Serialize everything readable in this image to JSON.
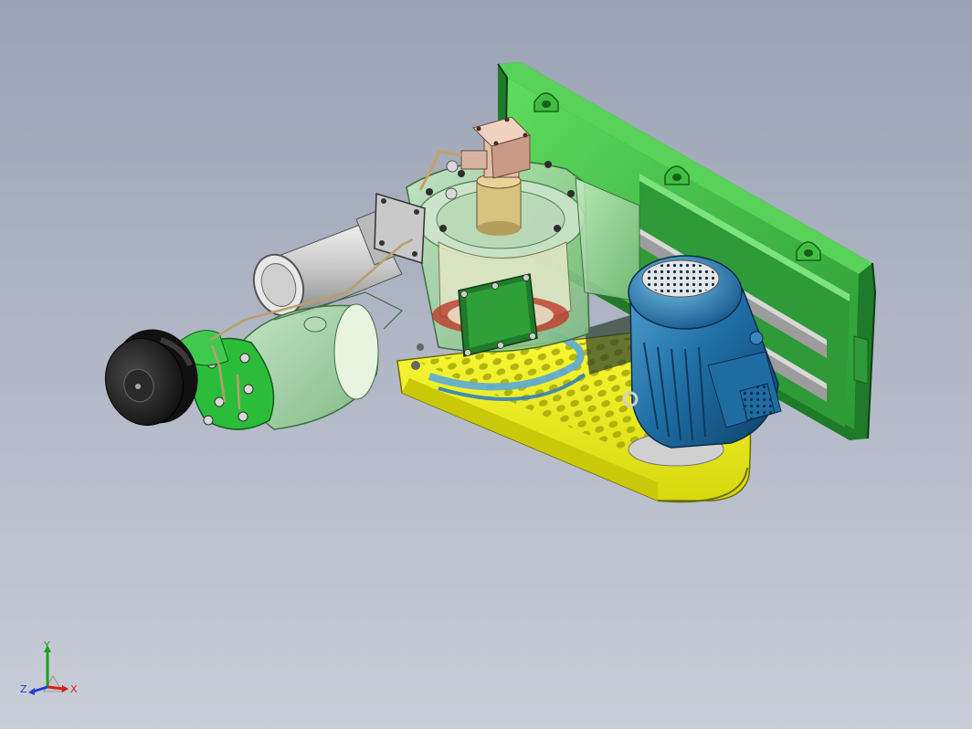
{
  "viewport": {
    "background_top": "#9aa2b4",
    "background_bottom": "#c9cdd8"
  },
  "colors": {
    "frame_green": "#3fb83f",
    "frame_dark_green": "#1f7a2a",
    "base_yellow": "#f2f21c",
    "motor_blue": "#1e6fa8",
    "pipe_green": "#7fcf7f",
    "pulley_black": "#1a1a1a"
  },
  "triad": {
    "x_label": "X",
    "y_label": "Y",
    "z_label": "Z",
    "x_color": "#d42020",
    "y_color": "#1fa01f",
    "z_color": "#2040c8"
  }
}
